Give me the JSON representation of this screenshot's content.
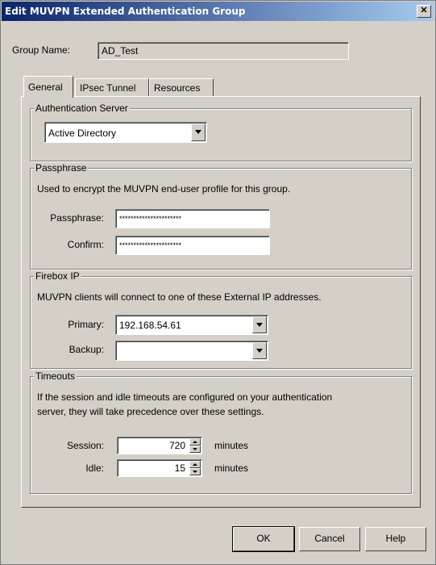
{
  "window": {
    "title": "Edit MUVPN Extended Authentication Group",
    "close_glyph": "✕"
  },
  "group_name": {
    "label": "Group Name:",
    "value": "AD_Test"
  },
  "tabs": [
    {
      "label": "General"
    },
    {
      "label": "IPsec Tunnel"
    },
    {
      "label": "Resources"
    }
  ],
  "auth_server": {
    "legend": "Authentication Server",
    "selected": "Active Directory"
  },
  "passphrase": {
    "legend": "Passphrase",
    "description": "Used to encrypt the MUVPN end-user profile for this group.",
    "passphrase_label": "Passphrase:",
    "passphrase_value": "**********************",
    "confirm_label": "Confirm:",
    "confirm_value": "**********************"
  },
  "firebox_ip": {
    "legend": "Firebox IP",
    "description": "MUVPN clients will connect to one of these External IP addresses.",
    "primary_label": "Primary:",
    "primary_value": "192.168.54.61",
    "backup_label": "Backup:",
    "backup_value": ""
  },
  "timeouts": {
    "legend": "Timeouts",
    "description_line1": "If the session and idle timeouts are configured on your authentication",
    "description_line2": "server, they will take precedence over these settings.",
    "session_label": "Session:",
    "session_value": "720",
    "session_unit": "minutes",
    "idle_label": "Idle:",
    "idle_value": "15",
    "idle_unit": "minutes"
  },
  "buttons": {
    "ok": "OK",
    "cancel": "Cancel",
    "help": "Help"
  }
}
